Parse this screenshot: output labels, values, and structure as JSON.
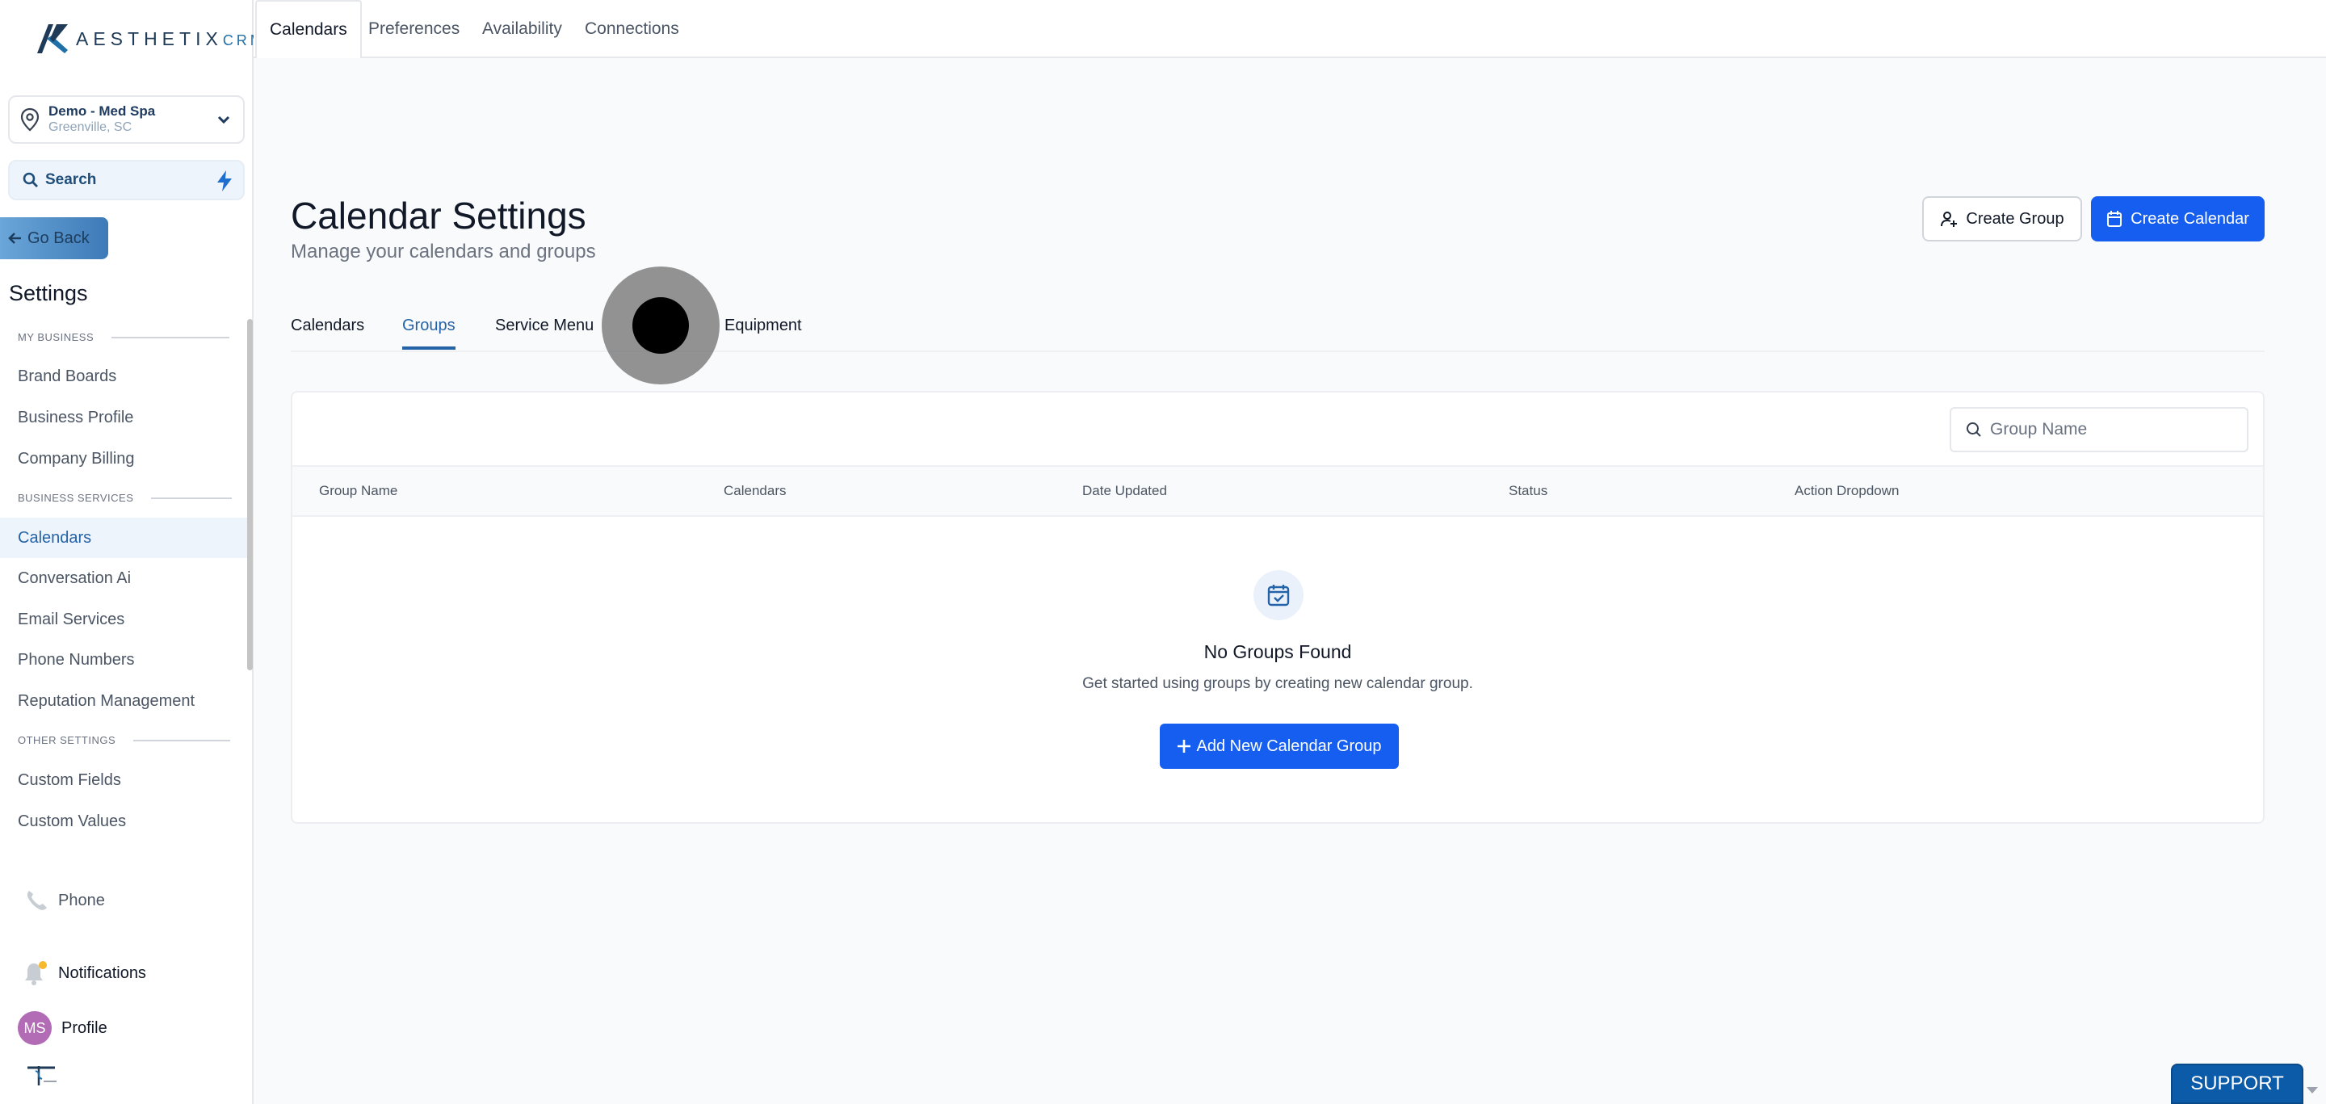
{
  "brand": {
    "logo_main": "AESTHETIX",
    "logo_suffix": "CRM"
  },
  "location": {
    "name": "Demo - Med Spa",
    "city": "Greenville, SC"
  },
  "sidebar": {
    "search_label": "Search",
    "go_back": "Go Back",
    "settings_title": "Settings",
    "sections": {
      "my_business": "MY BUSINESS",
      "business_services": "BUSINESS SERVICES",
      "other_settings": "OTHER SETTINGS"
    },
    "items": [
      "Brand Boards",
      "Business Profile",
      "Company Billing",
      "Calendars",
      "Conversation Ai",
      "Email Services",
      "Phone Numbers",
      "Reputation Management",
      "Custom Fields",
      "Custom Values"
    ],
    "active_item": "Calendars",
    "bottom": {
      "phone": "Phone",
      "notifications": "Notifications",
      "profile": "Profile",
      "avatar_initials": "MS"
    }
  },
  "top_tabs": [
    "Calendars",
    "Preferences",
    "Availability",
    "Connections"
  ],
  "header": {
    "title": "Calendar Settings",
    "subtitle": "Manage your calendars and groups",
    "create_group": "Create Group",
    "create_calendar": "Create Calendar"
  },
  "sub_tabs": [
    "Calendars",
    "Groups",
    "Service Menu",
    "Equipment"
  ],
  "active_sub_tab": "Groups",
  "table": {
    "search_placeholder": "Group Name",
    "columns": [
      "Group Name",
      "Calendars",
      "Date Updated",
      "Status",
      "Action Dropdown"
    ],
    "rows": []
  },
  "empty_state": {
    "title": "No Groups Found",
    "description": "Get started using groups by creating new calendar group.",
    "button": "Add New Calendar Group"
  },
  "support_label": "SUPPORT",
  "colors": {
    "primary": "#155eef",
    "active_nav": "#2563a8",
    "avatar": "#b26bb5"
  }
}
